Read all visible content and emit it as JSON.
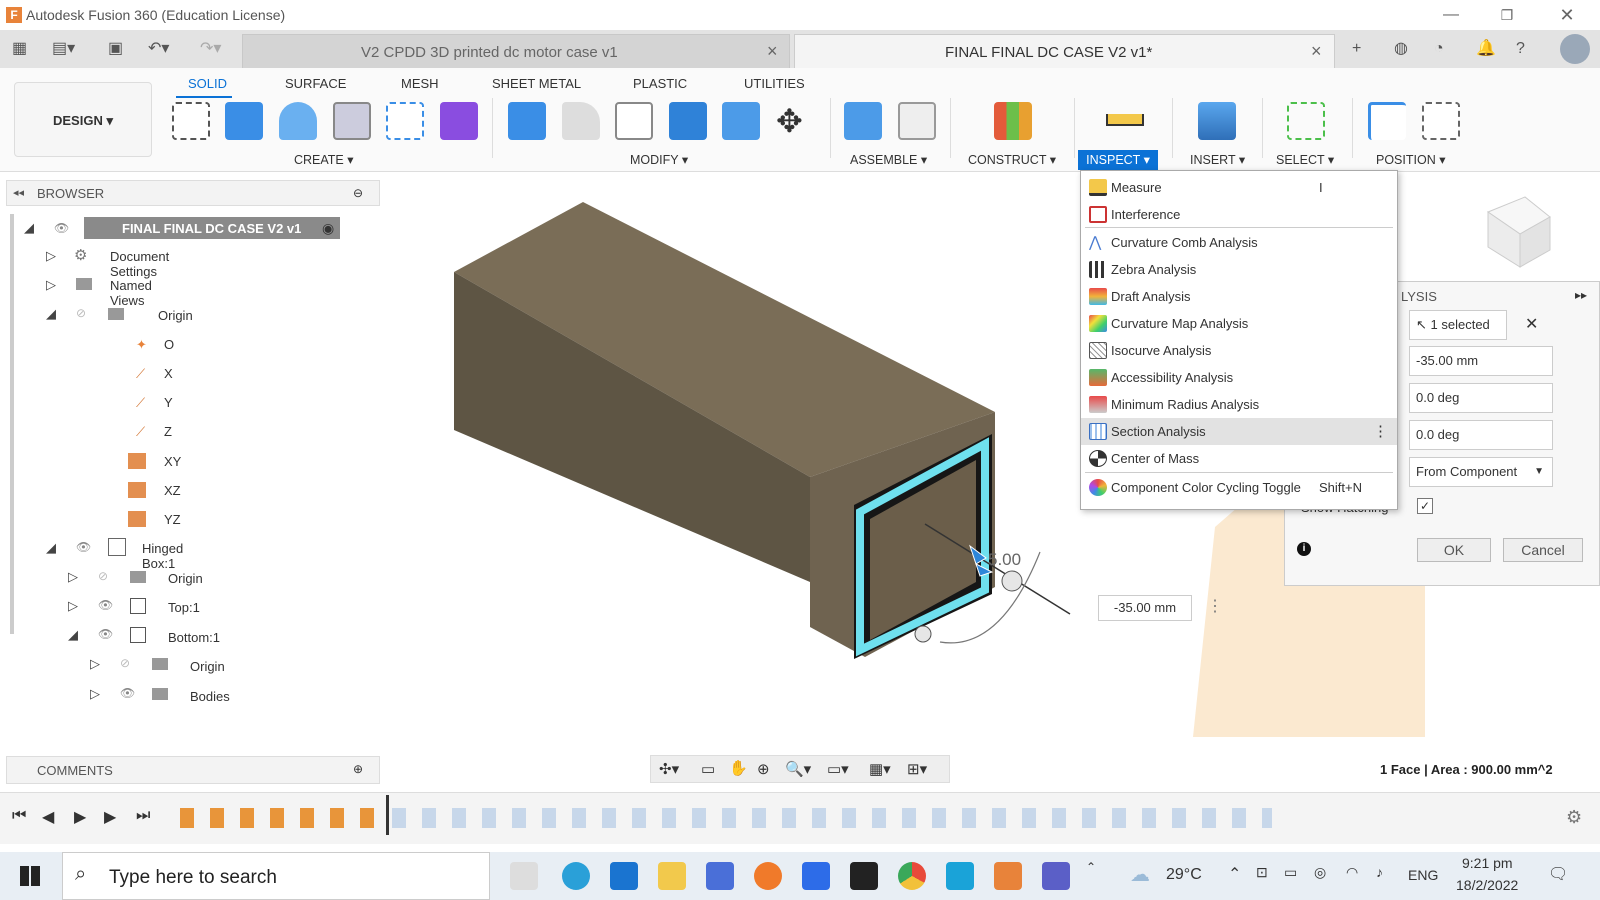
{
  "app": {
    "title": "Autodesk Fusion 360 (Education License)",
    "logo": "F"
  },
  "tabs": [
    {
      "label": "V2 CPDD 3D printed dc motor case v1"
    },
    {
      "label": "FINAL FINAL DC CASE V2 v1*"
    }
  ],
  "ribbon": {
    "workspace": "DESIGN",
    "tabs": [
      "SOLID",
      "SURFACE",
      "MESH",
      "SHEET METAL",
      "PLASTIC",
      "UTILITIES"
    ],
    "groups": [
      "CREATE",
      "MODIFY",
      "ASSEMBLE",
      "CONSTRUCT",
      "INSPECT",
      "INSERT",
      "SELECT",
      "POSITION"
    ]
  },
  "browser": {
    "title": "BROWSER",
    "root": "FINAL FINAL DC CASE V2 v1",
    "items": [
      "Document Settings",
      "Named Views",
      "Origin",
      "O",
      "X",
      "Y",
      "Z",
      "XY",
      "XZ",
      "YZ",
      "Hinged Box:1",
      "Origin",
      "Top:1",
      "Bottom:1",
      "Origin",
      "Bodies"
    ]
  },
  "inspect_menu": {
    "items": [
      {
        "label": "Measure",
        "shortcut": "I"
      },
      {
        "label": "Interference",
        "shortcut": ""
      },
      {
        "label": "Curvature Comb Analysis",
        "shortcut": ""
      },
      {
        "label": "Zebra Analysis",
        "shortcut": ""
      },
      {
        "label": "Draft Analysis",
        "shortcut": ""
      },
      {
        "label": "Curvature Map Analysis",
        "shortcut": ""
      },
      {
        "label": "Isocurve Analysis",
        "shortcut": ""
      },
      {
        "label": "Accessibility Analysis",
        "shortcut": ""
      },
      {
        "label": "Minimum Radius Analysis",
        "shortcut": ""
      },
      {
        "label": "Section Analysis",
        "shortcut": ""
      },
      {
        "label": "Center of Mass",
        "shortcut": ""
      },
      {
        "label": "Component Color Cycling Toggle",
        "shortcut": "Shift+N"
      }
    ]
  },
  "section_panel": {
    "title": "LYSIS",
    "selection": "1 selected",
    "distance": "-35.00 mm",
    "angle1": "0.0 deg",
    "angle2": "0.0 deg",
    "color_mode": "From Component",
    "hatching_label": "Show Hatching",
    "ok": "OK",
    "cancel": "Cancel"
  },
  "viewport": {
    "dim_value": "-35.00 mm",
    "dim_label": "5.00"
  },
  "comments": {
    "title": "COMMENTS"
  },
  "status": {
    "text": "1 Face | Area : 900.00 mm^2"
  },
  "taskbar": {
    "search_placeholder": "Type here to search",
    "temp": "29°C",
    "lang": "ENG",
    "time": "9:21 pm",
    "date": "18/2/2022"
  }
}
